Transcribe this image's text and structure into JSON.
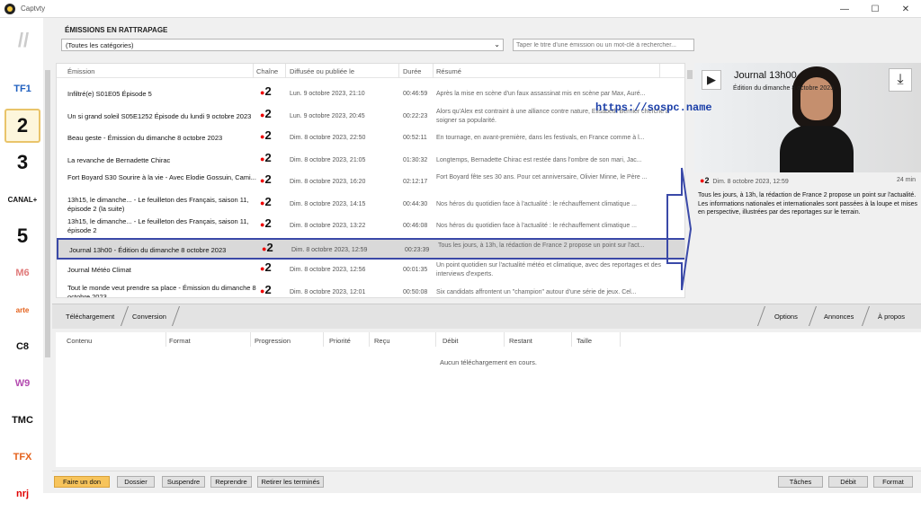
{
  "window": {
    "title": "Captvty"
  },
  "header": {
    "title": "ÉMISSIONS EN RATTRAPAGE",
    "category": "(Toutes les catégories)",
    "search_placeholder": "Taper le titre d'une émission ou un mot-clé à rechercher..."
  },
  "channels": [
    {
      "name": "TF1",
      "color": "#1f5fbf"
    },
    {
      "name": "2",
      "color": "#111111",
      "selected": true
    },
    {
      "name": "3",
      "color": "#111111"
    },
    {
      "name": "CANAL+",
      "color": "#111111"
    },
    {
      "name": "5",
      "color": "#111111"
    },
    {
      "name": "M6",
      "color": "#e07a7a"
    },
    {
      "name": "arte",
      "color": "#e4611b"
    },
    {
      "name": "C8",
      "color": "#111111"
    },
    {
      "name": "W9",
      "color": "#b44bb0"
    },
    {
      "name": "TMC",
      "color": "#111111"
    },
    {
      "name": "TFX",
      "color": "#e4611b"
    },
    {
      "name": "nrj",
      "color": "#e00000"
    }
  ],
  "table": {
    "headers": [
      "Émission",
      "Chaîne",
      "Diffusée ou publiée le",
      "Durée",
      "Résumé"
    ],
    "rows": [
      {
        "title": "Infiltré(e) S01E05 Épisode 5",
        "channel": "2",
        "date": "Lun. 9 octobre 2023, 21:10",
        "duration": "00:46:59",
        "summary": "Après la mise en scène d'un faux assassinat mis en scène par Max, Auré..."
      },
      {
        "title": "Un si grand soleil S05E1252 Épisode du lundi 9 octobre 2023",
        "channel": "2",
        "date": "Lun. 9 octobre 2023, 20:45",
        "duration": "00:22:23",
        "summary": "Alors qu'Alex est contraint à une alliance contre nature, Elisabeth Bernier cherche à soigner sa popularité."
      },
      {
        "title": "Beau geste - Émission du dimanche 8 octobre 2023",
        "channel": "2",
        "date": "Dim. 8 octobre 2023, 22:50",
        "duration": "00:52:11",
        "summary": "En tournage, en avant-première, dans les festivals, en France comme à l..."
      },
      {
        "title": "La revanche de Bernadette Chirac",
        "channel": "2",
        "date": "Dim. 8 octobre 2023, 21:05",
        "duration": "01:30:32",
        "summary": "Longtemps, Bernadette Chirac est restée dans l'ombre de son mari, Jac..."
      },
      {
        "title": "Fort Boyard S30 Sourire à la vie - Avec Elodie Gossuin, Cami...",
        "channel": "2",
        "date": "Dim. 8 octobre 2023, 16:20",
        "duration": "02:12:17",
        "summary": "Fort Boyard fête ses 30 ans. Pour cet anniversaire, Olivier Minne, le Père ..."
      },
      {
        "title": "13h15, le dimanche... - Le feuilleton des Français, saison 11, épisode 2 (la suite)",
        "channel": "2",
        "date": "Dim. 8 octobre 2023, 14:15",
        "duration": "00:44:30",
        "summary": "Nos héros du quotidien face à l'actualité : le réchauffement climatique ..."
      },
      {
        "title": "13h15, le dimanche... - Le feuilleton des Français, saison 11, épisode 2",
        "channel": "2",
        "date": "Dim. 8 octobre 2023, 13:22",
        "duration": "00:46:08",
        "summary": "Nos héros du quotidien face à l'actualité : le réchauffement climatique ..."
      },
      {
        "title": "Journal 13h00 - Édition du dimanche 8 octobre 2023",
        "channel": "2",
        "date": "Dim. 8 octobre 2023, 12:59",
        "duration": "00:23:39",
        "summary": "Tous les jours, à 13h, la rédaction de France 2 propose un point sur l'act..."
      },
      {
        "title": "Journal Météo Climat",
        "channel": "2",
        "date": "Dim. 8 octobre 2023, 12:56",
        "duration": "00:01:35",
        "summary": "Un point quotidien sur l'actualité météo et climatique, avec des reportages et des interviews d'experts."
      },
      {
        "title": "Tout le monde veut prendre sa place - Émission du dimanche 8 octobre 2023",
        "channel": "2",
        "date": "Dim. 8 octobre 2023, 12:01",
        "duration": "00:50:08",
        "summary": "Six candidats affrontent un \"champion\" autour d'une série de jeux. Cel..."
      }
    ]
  },
  "preview": {
    "title": "Journal 13h00",
    "subtitle": "Édition du dimanche 8 octobre 2023",
    "watermark": "https://sospc.name",
    "channel": "2",
    "date": "Dim. 8 octobre 2023, 12:59",
    "duration": "24 min",
    "description": "Tous les jours, à 13h, la rédaction de France 2 propose un point sur l'actualité. Les informations nationales et internationales sont passées à la loupe et mises en perspective, illustrées par des reportages sur le terrain."
  },
  "downloads": {
    "tabs_left": [
      "Téléchargement",
      "Conversion"
    ],
    "tabs_right": [
      "Options",
      "Annonces",
      "À propos"
    ],
    "headers": [
      "Contenu",
      "Format",
      "Progression",
      "Priorité",
      "Reçu",
      "Débit",
      "Restant",
      "Taille"
    ],
    "empty": "Aucun téléchargement en cours."
  },
  "bottom": {
    "left": [
      "Faire un don",
      "Dossier",
      "Suspendre",
      "Reprendre",
      "Retirer les terminés"
    ],
    "right": [
      "Tâches",
      "Débit",
      "Format"
    ]
  }
}
